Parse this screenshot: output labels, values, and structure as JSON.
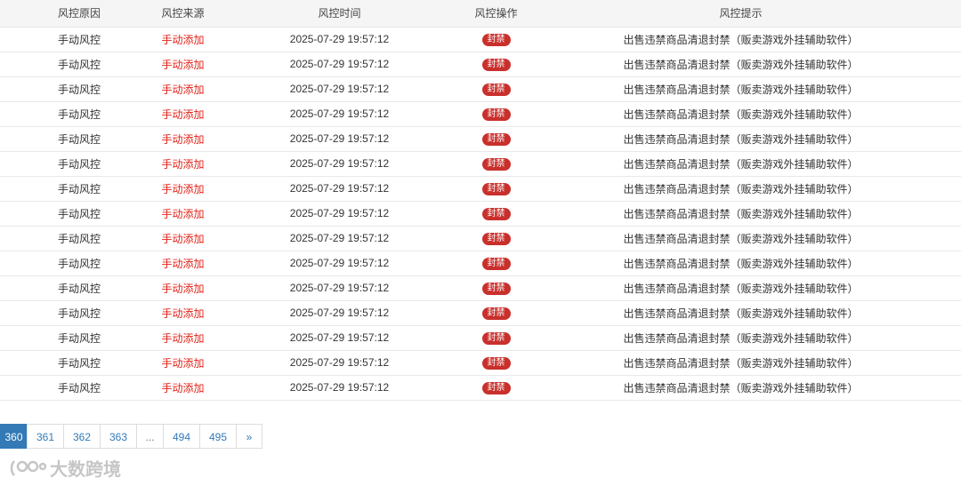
{
  "table": {
    "headers": [
      "风控原因",
      "风控来源",
      "风控时间",
      "风控操作",
      "风控提示"
    ],
    "rows": [
      {
        "reason": "手动风控",
        "source": "手动添加",
        "time": "2025-07-29 19:57:12",
        "action": "封禁",
        "tip": "出售违禁商品清退封禁（贩卖游戏外挂辅助软件）"
      },
      {
        "reason": "手动风控",
        "source": "手动添加",
        "time": "2025-07-29 19:57:12",
        "action": "封禁",
        "tip": "出售违禁商品清退封禁（贩卖游戏外挂辅助软件）"
      },
      {
        "reason": "手动风控",
        "source": "手动添加",
        "time": "2025-07-29 19:57:12",
        "action": "封禁",
        "tip": "出售违禁商品清退封禁（贩卖游戏外挂辅助软件）"
      },
      {
        "reason": "手动风控",
        "source": "手动添加",
        "time": "2025-07-29 19:57:12",
        "action": "封禁",
        "tip": "出售违禁商品清退封禁（贩卖游戏外挂辅助软件）"
      },
      {
        "reason": "手动风控",
        "source": "手动添加",
        "time": "2025-07-29 19:57:12",
        "action": "封禁",
        "tip": "出售违禁商品清退封禁（贩卖游戏外挂辅助软件）"
      },
      {
        "reason": "手动风控",
        "source": "手动添加",
        "time": "2025-07-29 19:57:12",
        "action": "封禁",
        "tip": "出售违禁商品清退封禁（贩卖游戏外挂辅助软件）"
      },
      {
        "reason": "手动风控",
        "source": "手动添加",
        "time": "2025-07-29 19:57:12",
        "action": "封禁",
        "tip": "出售违禁商品清退封禁（贩卖游戏外挂辅助软件）"
      },
      {
        "reason": "手动风控",
        "source": "手动添加",
        "time": "2025-07-29 19:57:12",
        "action": "封禁",
        "tip": "出售违禁商品清退封禁（贩卖游戏外挂辅助软件）"
      },
      {
        "reason": "手动风控",
        "source": "手动添加",
        "time": "2025-07-29 19:57:12",
        "action": "封禁",
        "tip": "出售违禁商品清退封禁（贩卖游戏外挂辅助软件）"
      },
      {
        "reason": "手动风控",
        "source": "手动添加",
        "time": "2025-07-29 19:57:12",
        "action": "封禁",
        "tip": "出售违禁商品清退封禁（贩卖游戏外挂辅助软件）"
      },
      {
        "reason": "手动风控",
        "source": "手动添加",
        "time": "2025-07-29 19:57:12",
        "action": "封禁",
        "tip": "出售违禁商品清退封禁（贩卖游戏外挂辅助软件）"
      },
      {
        "reason": "手动风控",
        "source": "手动添加",
        "time": "2025-07-29 19:57:12",
        "action": "封禁",
        "tip": "出售违禁商品清退封禁（贩卖游戏外挂辅助软件）"
      },
      {
        "reason": "手动风控",
        "source": "手动添加",
        "time": "2025-07-29 19:57:12",
        "action": "封禁",
        "tip": "出售违禁商品清退封禁（贩卖游戏外挂辅助软件）"
      },
      {
        "reason": "手动风控",
        "source": "手动添加",
        "time": "2025-07-29 19:57:12",
        "action": "封禁",
        "tip": "出售违禁商品清退封禁（贩卖游戏外挂辅助软件）"
      },
      {
        "reason": "手动风控",
        "source": "手动添加",
        "time": "2025-07-29 19:57:12",
        "action": "封禁",
        "tip": "出售违禁商品清退封禁（贩卖游戏外挂辅助软件）"
      }
    ]
  },
  "pagination": {
    "pages": [
      "360",
      "361",
      "362",
      "363",
      "...",
      "494",
      "495",
      "»"
    ],
    "active": "360"
  },
  "watermark": {
    "text": "大数跨境",
    "icon": "brand-logo-icon"
  },
  "colors": {
    "source_red": "#e2231a",
    "badge_red": "#c9302c",
    "page_blue": "#337ab7"
  }
}
